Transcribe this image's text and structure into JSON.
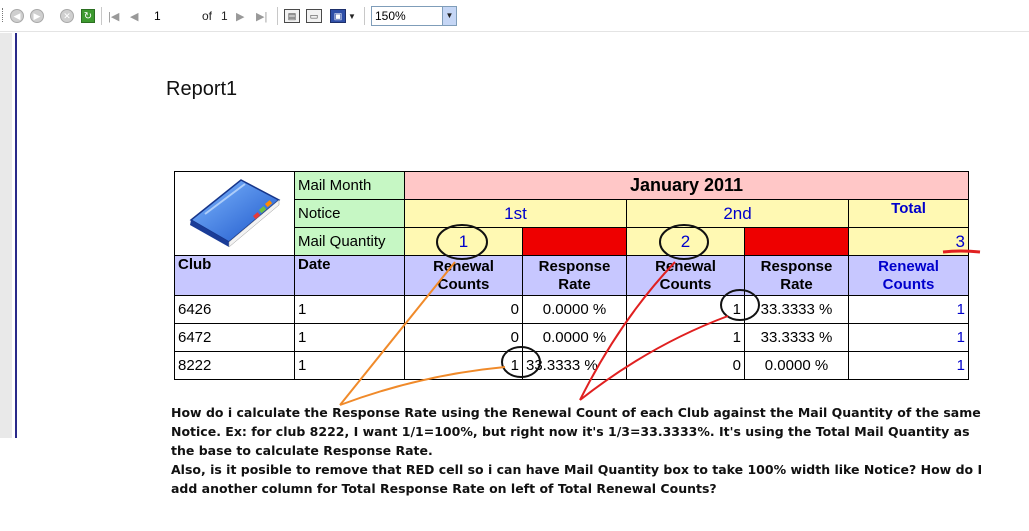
{
  "toolbar": {
    "page_current": "1",
    "page_of_label": "of",
    "page_total": "1",
    "zoom": "150%"
  },
  "report": {
    "title": "Report1",
    "header": {
      "mail_month_label": "Mail Month",
      "month_value": "January 2011",
      "notice_label": "Notice",
      "notice_1": "1st",
      "notice_2": "2nd",
      "total_label": "Total",
      "mail_qty_label": "Mail Quantity",
      "qty_1": "1",
      "qty_2": "2",
      "qty_total": "3"
    },
    "columns": {
      "club": "Club",
      "date": "Date",
      "renewal_counts": "Renewal Counts",
      "response_rate": "Response Rate",
      "total_renewal_counts": "Renewal Counts"
    },
    "rows": [
      {
        "club": "6426",
        "date": "1",
        "ren1": "0",
        "rate1": "0.0000 %",
        "ren2": "1",
        "rate2": "33.3333 %",
        "total": "1"
      },
      {
        "club": "6472",
        "date": "1",
        "ren1": "0",
        "rate1": "0.0000 %",
        "ren2": "1",
        "rate2": "33.3333 %",
        "total": "1"
      },
      {
        "club": "8222",
        "date": "1",
        "ren1": "1",
        "rate1": "33.3333 %",
        "ren2": "0",
        "rate2": "0.0000 %",
        "total": "1"
      }
    ]
  },
  "question": {
    "line1": "How do i calculate the Response Rate using the Renewal Count of each Club against the Mail Quantity of the same",
    "line2": "Notice. Ex: for club 8222, I want 1/1=100%, but right now it's 1/3=33.3333%. It's using the Total Mail Quantity as",
    "line3": "the base to calculate Response Rate.",
    "line4": "Also, is it posible to remove that RED cell so i can have Mail Quantity box to take 100% width like Notice? How do I",
    "line5": "add another column for Total Response Rate on left of Total Renewal Counts?"
  },
  "colors": {
    "mail_label_green": "#c6f7c4",
    "month_pink": "#ffc7c7",
    "notice_yellow": "#fff9b3",
    "red_cell": "#ee0000",
    "header_lavender": "#c7c7ff",
    "annotation_orange": "#f08a2a",
    "annotation_red": "#e02020"
  }
}
